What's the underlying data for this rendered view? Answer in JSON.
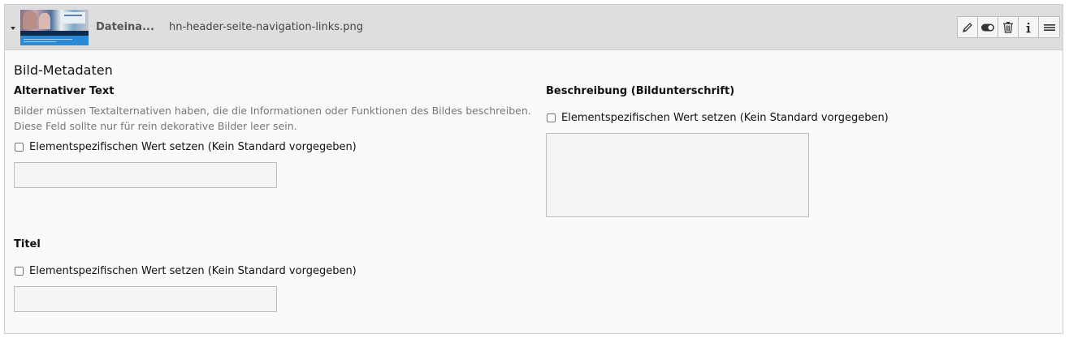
{
  "header": {
    "field_label": "Dateina...",
    "filename": "hn-header-seite-navigation-links.png",
    "toolbar": [
      {
        "name": "edit-button",
        "icon": "pencil-icon"
      },
      {
        "name": "toggle-visibility-button",
        "icon": "toggle-icon"
      },
      {
        "name": "delete-button",
        "icon": "trash-icon"
      },
      {
        "name": "info-button",
        "icon": "info-icon"
      },
      {
        "name": "drag-handle-button",
        "icon": "menu-lines-icon"
      }
    ]
  },
  "section": {
    "title": "Bild-Metadaten"
  },
  "alt_text": {
    "label": "Alternativer Text",
    "help_line1": "Bilder müssen Textalternativen haben, die die Informationen oder Funktionen des Bildes beschreiben.",
    "help_line2": "Diese Feld sollte nur für rein dekorative Bilder leer sein.",
    "override_label": "Elementspezifischen Wert setzen (Kein Standard vorgegeben)",
    "value": ""
  },
  "description": {
    "label": "Beschreibung (Bildunterschrift)",
    "override_label": "Elementspezifischen Wert setzen (Kein Standard vorgegeben)",
    "value": ""
  },
  "title_field": {
    "label": "Titel",
    "override_label": "Elementspezifischen Wert setzen (Kein Standard vorgegeben)",
    "value": ""
  }
}
